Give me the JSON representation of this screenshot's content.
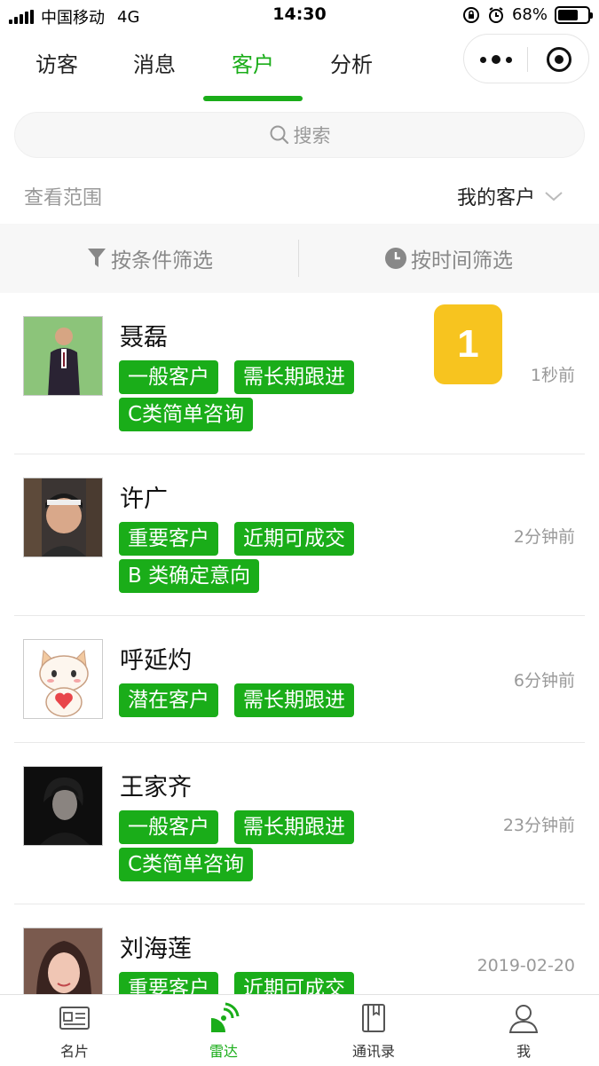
{
  "status_bar": {
    "carrier": "中国移动",
    "network": "4G",
    "time": "14:30",
    "battery": "68%",
    "battery_level": 0.68
  },
  "tabs": [
    {
      "label": "访客",
      "active": false
    },
    {
      "label": "消息",
      "active": false
    },
    {
      "label": "客户",
      "active": true
    },
    {
      "label": "分析",
      "active": false
    }
  ],
  "search": {
    "placeholder": "搜索"
  },
  "scope": {
    "label": "查看范围",
    "value": "我的客户"
  },
  "filters": {
    "condition": "按条件筛选",
    "time": "按时间筛选"
  },
  "customers": [
    {
      "name": "聂磊",
      "tags": [
        "一般客户",
        "需长期跟进",
        "C类简单咨询"
      ],
      "time": "1秒前",
      "badge": "1"
    },
    {
      "name": "许广",
      "tags": [
        "重要客户",
        "近期可成交",
        "B 类确定意向"
      ],
      "time": "2分钟前"
    },
    {
      "name": "呼延灼",
      "tags": [
        "潜在客户",
        "需长期跟进"
      ],
      "time": "6分钟前"
    },
    {
      "name": "王家齐",
      "tags": [
        "一般客户",
        "需长期跟进",
        "C类简单咨询"
      ],
      "time": "23分钟前"
    },
    {
      "name": "刘海莲",
      "tags": [
        "重要客户",
        "近期可成交"
      ],
      "time": "2019-02-20"
    }
  ],
  "bottom_nav": [
    {
      "label": "名片",
      "icon": "card-icon",
      "active": false
    },
    {
      "label": "雷达",
      "icon": "radar-icon",
      "active": true
    },
    {
      "label": "通讯录",
      "icon": "contacts-book-icon",
      "active": false
    },
    {
      "label": "我",
      "icon": "person-icon",
      "active": false
    }
  ],
  "colors": {
    "accent": "#1aad19",
    "badge": "#f7c41f",
    "muted": "#999999"
  }
}
